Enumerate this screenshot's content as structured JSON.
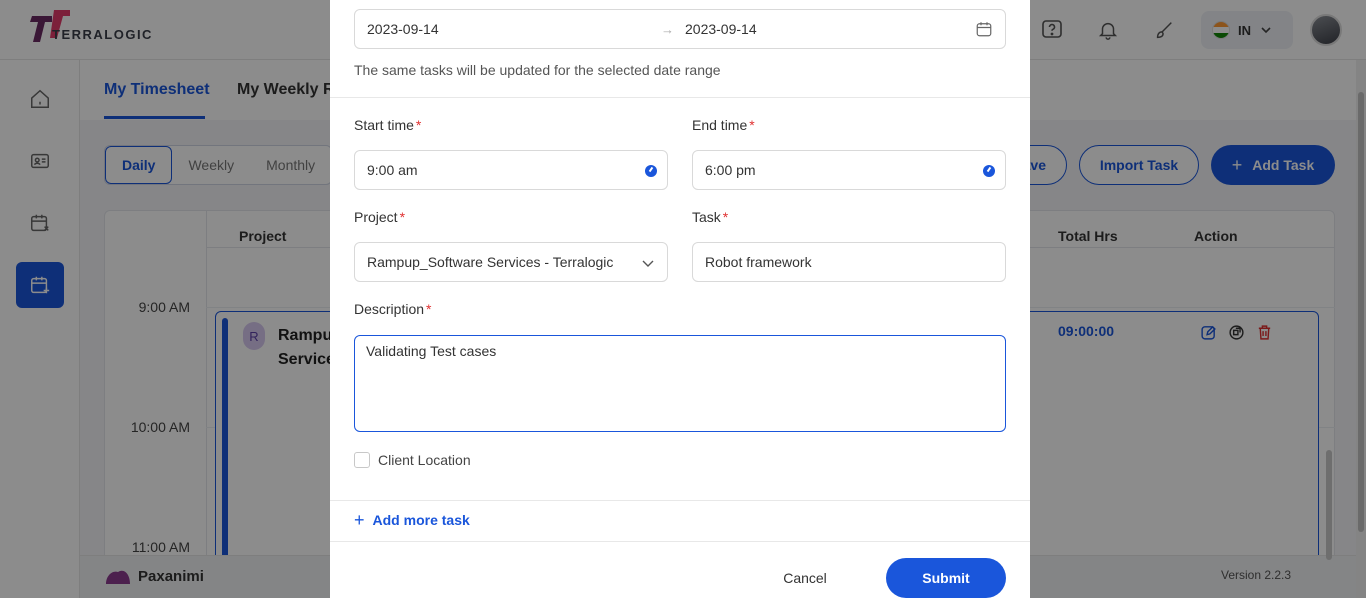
{
  "app": {
    "logo_text": "TERRALOGIC",
    "language": "IN",
    "footer_brand": "Paxanimi",
    "version": "Version 2.2.3"
  },
  "tabs": [
    {
      "label": "My Timesheet",
      "active": true
    },
    {
      "label": "My Weekly Re"
    }
  ],
  "view_toggle": [
    "Daily",
    "Weekly",
    "Monthly"
  ],
  "toolbar": {
    "save_partial": "ave",
    "import_task": "Import Task",
    "add_task": "Add Task"
  },
  "table": {
    "headers": {
      "project": "Project",
      "total_hrs": "Total Hrs",
      "action": "Action"
    },
    "time_labels": [
      "9:00 AM",
      "10:00 AM",
      "11:00 AM"
    ],
    "task": {
      "avatar_letter": "R",
      "name_line1": "Rampu",
      "name_line2": "Service",
      "total": "09:00:00"
    }
  },
  "modal": {
    "date_start": "2023-09-14",
    "date_end": "2023-09-14",
    "date_arrow": "→",
    "date_hint": "The same tasks will be updated for the selected date range",
    "start_time_label": "Start time",
    "start_time_value": "9:00 am",
    "end_time_label": "End time",
    "end_time_value": "6:00 pm",
    "project_label": "Project",
    "project_value": "Rampup_Software Services - Terralogic",
    "task_label": "Task",
    "task_value": "Robot framework",
    "description_label": "Description",
    "description_value": "Validating Test cases",
    "required_mark": "*",
    "client_location_label": "Client Location",
    "add_more_label": "Add more task",
    "cancel_label": "Cancel",
    "submit_label": "Submit"
  },
  "colors": {
    "accent": "#1a56db",
    "required": "#e03131",
    "overlay": "rgba(0,0,0,0.45)"
  }
}
